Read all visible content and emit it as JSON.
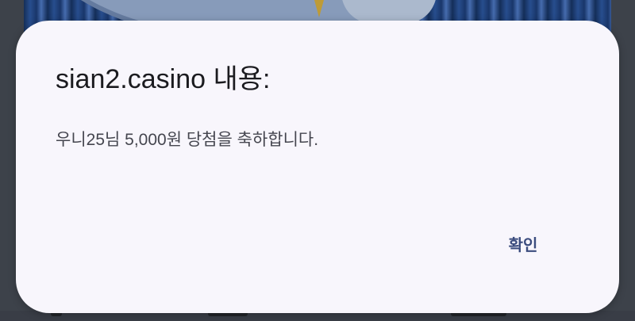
{
  "dialog": {
    "title": "sian2.casino 내용:",
    "message": "우니25님 5,000원 당첨을 축하합니다.",
    "ok_label": "확인"
  },
  "colors": {
    "dialog_background": "#f8f6fc",
    "title_text": "#1b1b1f",
    "message_text": "#45464f",
    "button_text": "#3b4c7e"
  }
}
